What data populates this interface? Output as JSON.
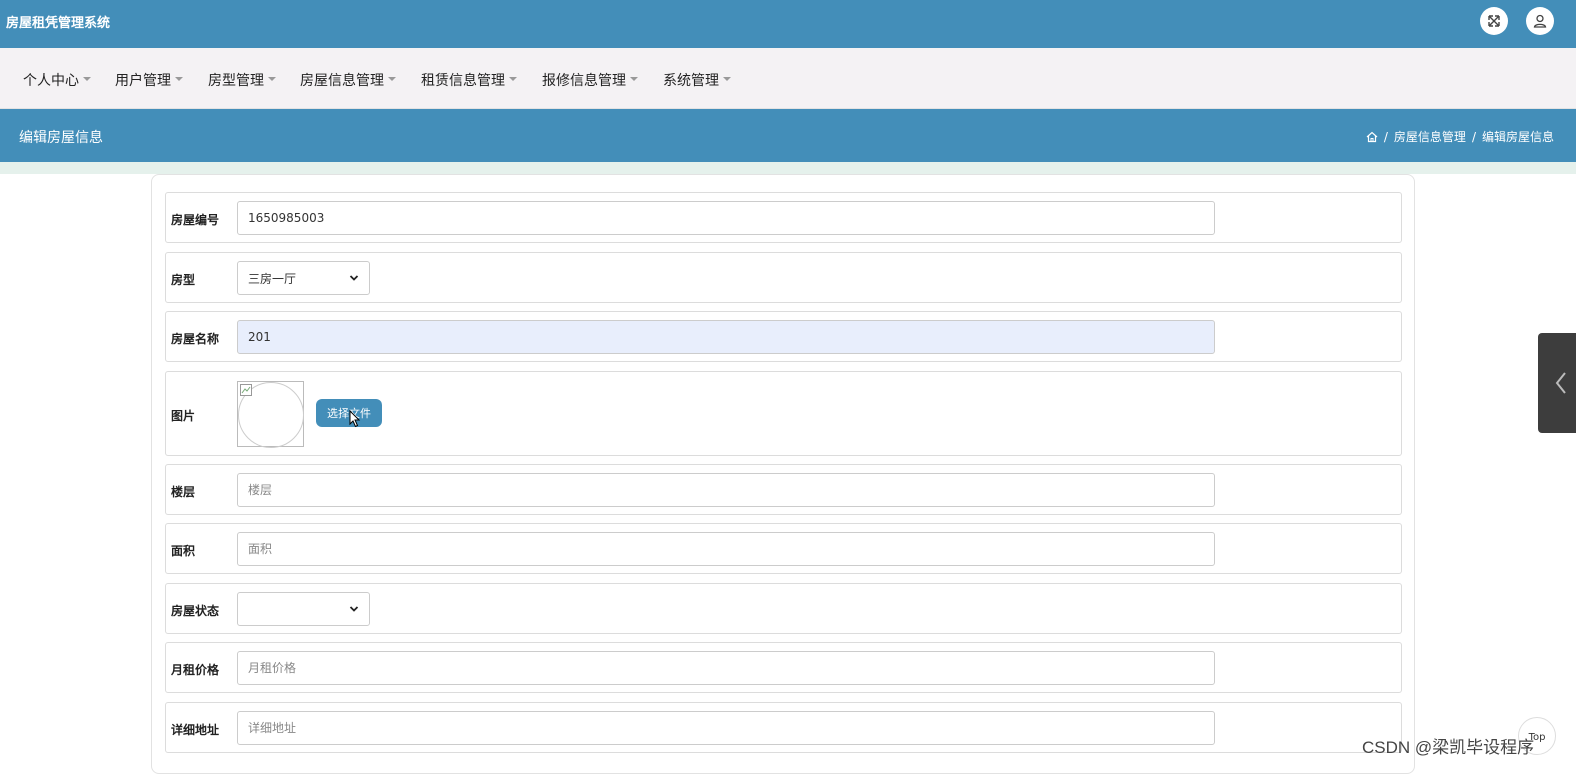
{
  "app": {
    "title": "房屋租凭管理系统"
  },
  "header": {
    "icons": [
      "fullscreen-icon",
      "user-icon"
    ]
  },
  "nav": {
    "items": [
      {
        "label": "个人中心"
      },
      {
        "label": "用户管理"
      },
      {
        "label": "房型管理"
      },
      {
        "label": "房屋信息管理"
      },
      {
        "label": "租赁信息管理"
      },
      {
        "label": "报修信息管理"
      },
      {
        "label": "系统管理"
      }
    ]
  },
  "page": {
    "title": "编辑房屋信息",
    "breadcrumb": [
      "房屋信息管理",
      "编辑房屋信息"
    ]
  },
  "form": {
    "house_no": {
      "label": "房屋编号",
      "value": "1650985003"
    },
    "house_type": {
      "label": "房型",
      "value": "三房一厅"
    },
    "house_name": {
      "label": "房屋名称",
      "value": "201"
    },
    "image": {
      "label": "图片",
      "button": "选择文件"
    },
    "floor": {
      "label": "楼层",
      "placeholder": "楼层"
    },
    "area": {
      "label": "面积",
      "placeholder": "面积"
    },
    "status": {
      "label": "房屋状态",
      "value": ""
    },
    "rent": {
      "label": "月租价格",
      "placeholder": "月租价格"
    },
    "address": {
      "label": "详细地址",
      "placeholder": "详细地址"
    }
  },
  "widgets": {
    "top_button": "Top",
    "watermark": "CSDN @梁凯毕设程序"
  },
  "colors": {
    "primary": "#438eb9",
    "nav_bg": "#f4f2f4",
    "focused_input": "#e8eefc"
  }
}
